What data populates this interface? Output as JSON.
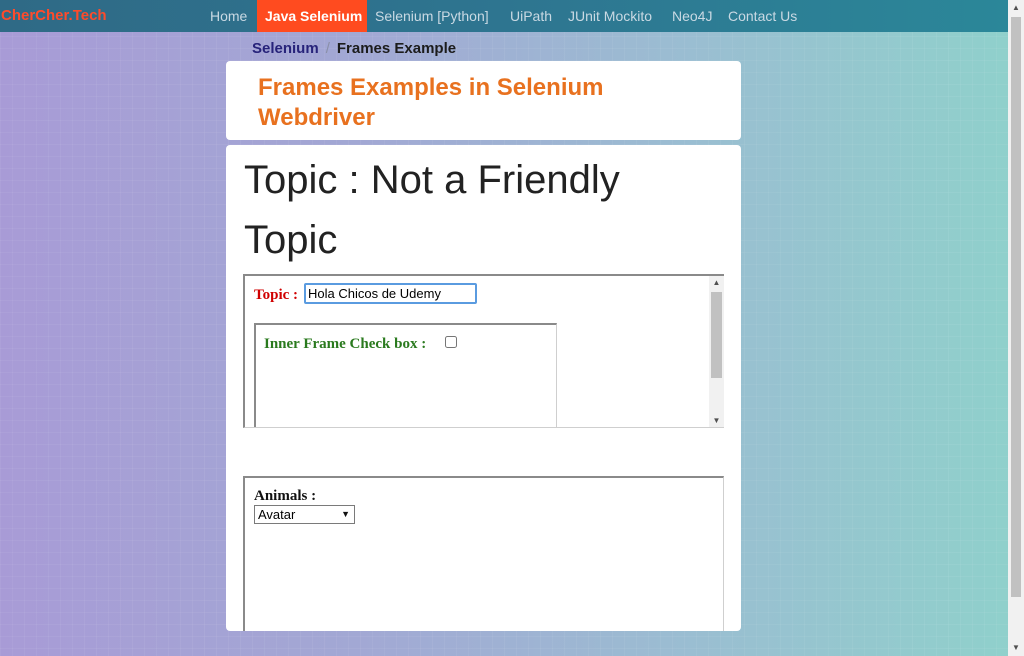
{
  "navbar": {
    "brand": "CherCher.Tech",
    "items": [
      {
        "label": "Home"
      },
      {
        "label": "Java Selenium",
        "active": true
      },
      {
        "label": "Selenium [Python]"
      },
      {
        "label": "UiPath"
      },
      {
        "label": "JUnit Mockito"
      },
      {
        "label": "Neo4J"
      },
      {
        "label": "Contact Us"
      }
    ]
  },
  "breadcrumb": {
    "link": "Selenium",
    "separator": "/",
    "current": "Frames Example"
  },
  "header": {
    "title": "Frames Examples in Selenium Webdriver"
  },
  "main": {
    "heading": "Topic : Not a Friendly Topic",
    "frame1": {
      "topic_label": "Topic :",
      "topic_value": "Hola Chicos de Udemy",
      "inner_frame": {
        "label": "Inner Frame Check box :",
        "checked": false
      }
    },
    "frame2": {
      "animals_label": "Animals :",
      "animals_selected": "Avatar"
    }
  },
  "colors": {
    "brand": "#ff4b2b",
    "active_tab": "#ff4b1f",
    "header_title": "#e8711f",
    "topic_label": "#d00000",
    "inner_label": "#2a7a1e"
  }
}
